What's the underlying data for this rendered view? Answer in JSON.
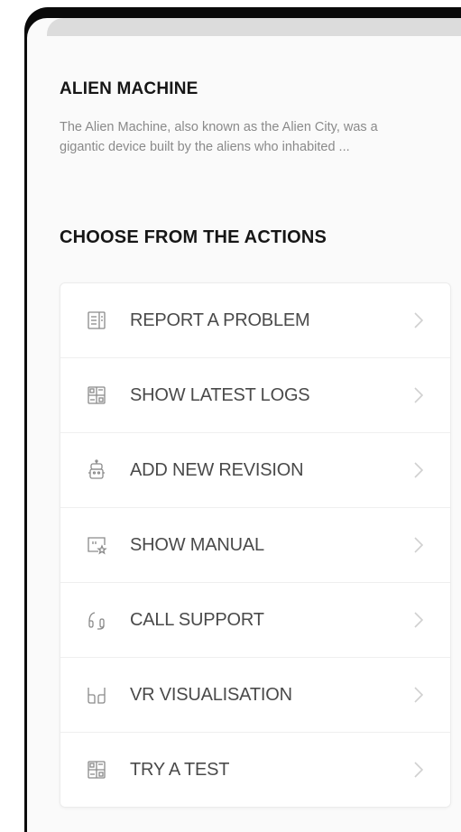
{
  "header": {
    "title": "ALIEN MACHINE",
    "description": "The Alien Machine, also known as the Alien City, was a gigantic device built by the aliens who inhabited ..."
  },
  "actions_section": {
    "title": "CHOOSE FROM THE ACTIONS",
    "items": [
      {
        "label": "REPORT A PROBLEM",
        "icon": "report-icon"
      },
      {
        "label": "SHOW LATEST LOGS",
        "icon": "logs-icon"
      },
      {
        "label": "ADD NEW REVISION",
        "icon": "robot-icon"
      },
      {
        "label": "SHOW MANUAL",
        "icon": "manual-icon"
      },
      {
        "label": "CALL SUPPORT",
        "icon": "headset-icon"
      },
      {
        "label": "VR VISUALISATION",
        "icon": "vr-icon"
      },
      {
        "label": "TRY A TEST",
        "icon": "test-icon"
      }
    ]
  },
  "colors": {
    "text_primary": "#161616",
    "text_secondary": "#8a8a8a",
    "icon": "#8a8a8a",
    "chevron": "#d0d0d0"
  }
}
